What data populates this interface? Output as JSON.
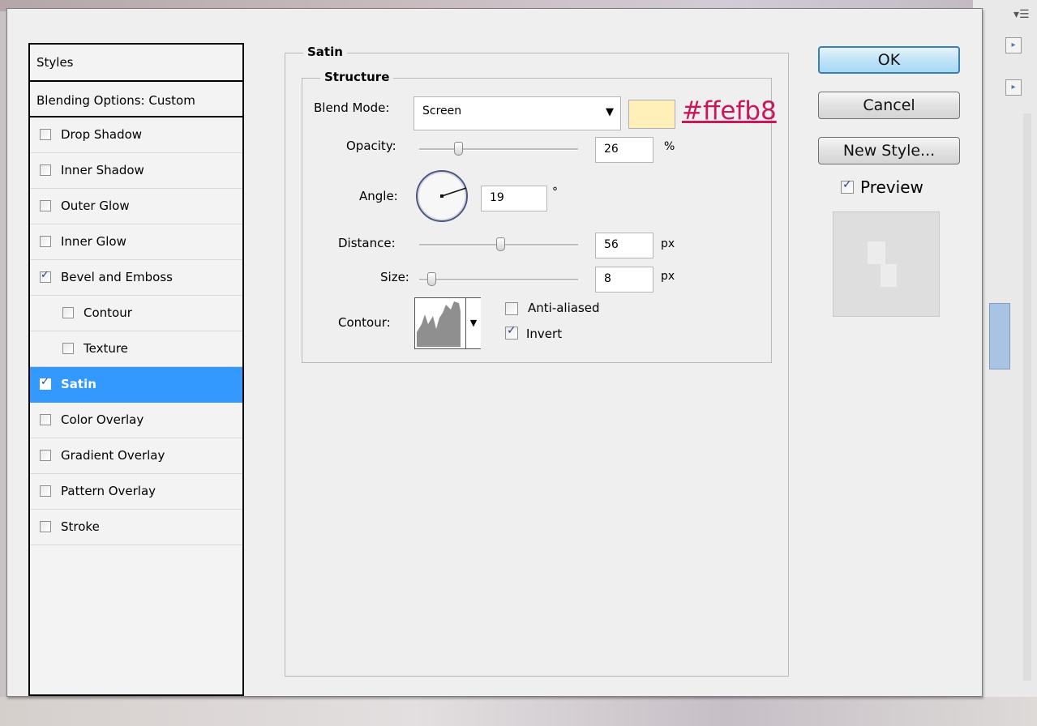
{
  "styles_panel": {
    "header": "Styles",
    "blending_options": "Blending Options: Custom",
    "effects": [
      {
        "label": "Drop Shadow",
        "checked": false
      },
      {
        "label": "Inner Shadow",
        "checked": false
      },
      {
        "label": "Outer Glow",
        "checked": false
      },
      {
        "label": "Inner Glow",
        "checked": false
      },
      {
        "label": "Bevel and Emboss",
        "checked": true
      },
      {
        "label": "Contour",
        "checked": false
      },
      {
        "label": "Texture",
        "checked": false
      },
      {
        "label": "Satin",
        "checked": true,
        "selected": true
      },
      {
        "label": "Color Overlay",
        "checked": false
      },
      {
        "label": "Gradient Overlay",
        "checked": false
      },
      {
        "label": "Pattern Overlay",
        "checked": false
      },
      {
        "label": "Stroke",
        "checked": false
      }
    ]
  },
  "satin": {
    "title": "Satin",
    "structure_title": "Structure",
    "blend_mode_label": "Blend Mode:",
    "blend_mode_value": "Screen",
    "color_hex": "#ffefb8",
    "color_annotation": "#ffefb8",
    "opacity_label": "Opacity:",
    "opacity_value": "26",
    "opacity_unit": "%",
    "angle_label": "Angle:",
    "angle_value": "19",
    "angle_unit": "°",
    "distance_label": "Distance:",
    "distance_value": "56",
    "distance_unit": "px",
    "size_label": "Size:",
    "size_value": "8",
    "size_unit": "px",
    "contour_label": "Contour:",
    "anti_aliased_label": "Anti-aliased",
    "anti_aliased": false,
    "invert_label": "Invert",
    "invert": true
  },
  "buttons": {
    "ok": "OK",
    "cancel": "Cancel",
    "new_style": "New Style...",
    "preview_label": "Preview",
    "preview_checked": true
  },
  "colors": {
    "selection": "#3399ff",
    "annotation": "#c8185a",
    "ok_border": "#3c7fb1"
  }
}
